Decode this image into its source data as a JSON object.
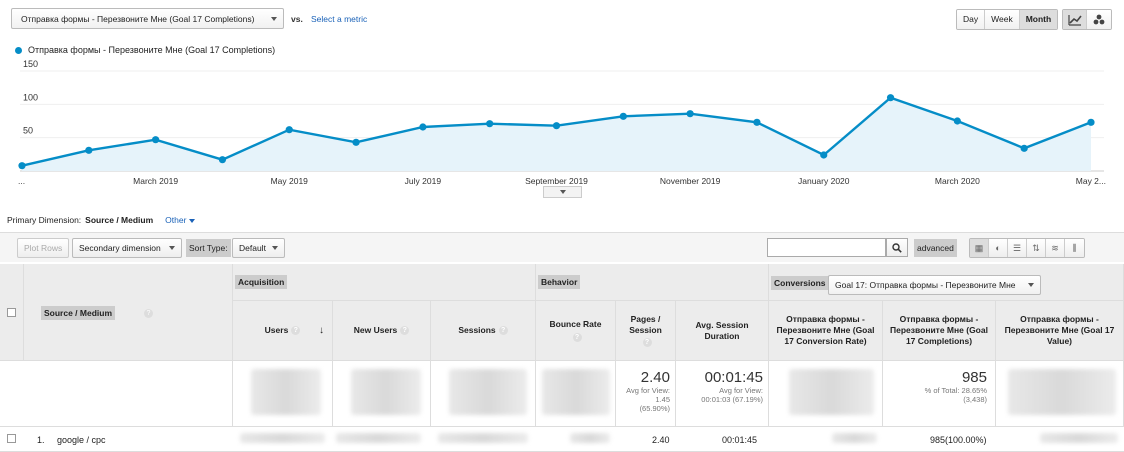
{
  "metric_selector": {
    "label": "Отправка формы - Перезвоните Мне (Goal 17 Completions)"
  },
  "vs_label": "vs.",
  "select_metric_label": "Select a metric",
  "range": {
    "day": "Day",
    "week": "Week",
    "month": "Month",
    "selected": "Month"
  },
  "legend": {
    "series_label": "Отправка формы - Перезвоните Мне (Goal 17 Completions)",
    "color": "#058dc7"
  },
  "chart_data": {
    "type": "area",
    "y_ticks": [
      "150",
      "100",
      "50"
    ],
    "ylim": [
      0,
      150
    ],
    "x_tick_labels": [
      "...",
      "March 2019",
      "May 2019",
      "July 2019",
      "September 2019",
      "November 2019",
      "January 2020",
      "March 2020",
      "May 2..."
    ],
    "series": [
      {
        "name": "Отправка формы - Перезвоните Мне (Goal 17 Completions)",
        "values": [
          8,
          31,
          47,
          17,
          62,
          43,
          66,
          71,
          68,
          82,
          86,
          73,
          24,
          110,
          75,
          34,
          73
        ]
      }
    ]
  },
  "primary_dimension": {
    "label": "Primary Dimension:",
    "current": "Source / Medium",
    "other": "Other"
  },
  "toolbar": {
    "plot_rows": "Plot Rows",
    "secondary_dimension": "Secondary dimension",
    "sort_type_label": "Sort Type:",
    "sort_type_value": "Default",
    "advanced": "advanced"
  },
  "table": {
    "groups": {
      "acquisition": "Acquisition",
      "behavior": "Behavior",
      "conversions": "Conversions"
    },
    "conversion_goal": "Goal 17: Отправка формы - Перезвоните Мне",
    "dimension_header": "Source / Medium",
    "columns": {
      "users": "Users",
      "new_users": "New Users",
      "sessions": "Sessions",
      "bounce_rate": "Bounce Rate",
      "pages_session": "Pages / Session",
      "avg_session_duration": "Avg. Session Duration",
      "conv_rate": "Отправка формы - Перезвоните Мне (Goal 17 Conversion Rate)",
      "completions": "Отправка формы - Перезвоните Мне (Goal 17 Completions)",
      "value": "Отправка формы - Перезвоните Мне (Goal 17 Value)"
    },
    "totals": {
      "pages_session": "2.40",
      "pages_session_sub": "Avg for View: 1.45 (65.90%)",
      "avg_duration": "00:01:45",
      "avg_duration_sub": "Avg for View: 00:01:03 (67.19%)",
      "completions": "985",
      "completions_sub": "% of Total: 28.65% (3,438)"
    },
    "rows": [
      {
        "index": "1.",
        "source": "google / cpc",
        "pages_session": "2.40",
        "avg_duration": "00:01:45",
        "completions": "985(100.00%)"
      }
    ]
  }
}
